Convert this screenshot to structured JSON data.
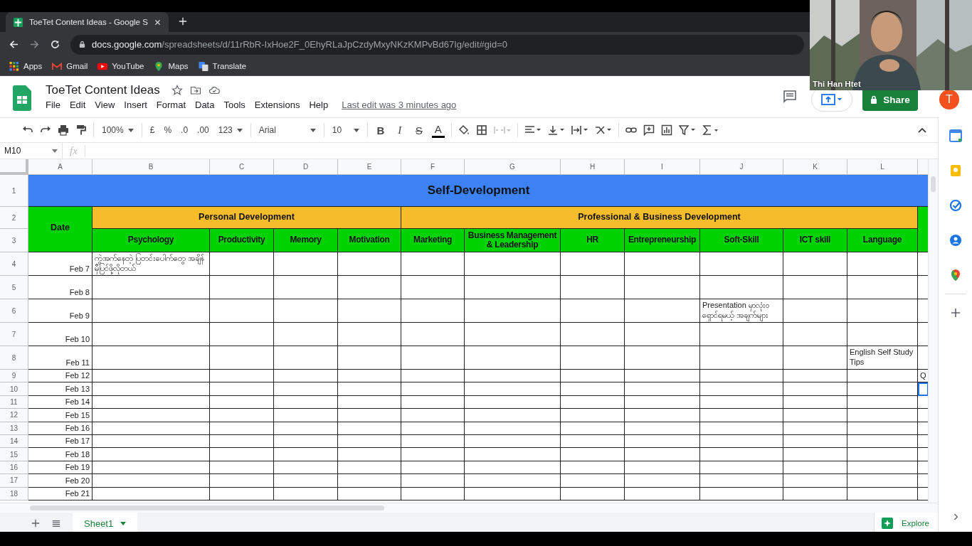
{
  "browser": {
    "tab_title": "ToeTet Content Ideas - Google S",
    "url_host": "docs.google.com",
    "url_path": "/spreadsheets/d/11rRbR-IxHoe2F_0EhyRLaJpCzdyMxyNKzKMPvBd67Ig/edit#gid=0",
    "bookmarks": [
      {
        "label": "Apps",
        "kind": "apps"
      },
      {
        "label": "Gmail",
        "kind": "gmail"
      },
      {
        "label": "YouTube",
        "kind": "youtube"
      },
      {
        "label": "Maps",
        "kind": "maps"
      },
      {
        "label": "Translate",
        "kind": "translate"
      }
    ]
  },
  "video": {
    "name": "Thi Han Htet"
  },
  "doc": {
    "title": "ToeTet Content Ideas",
    "menu": [
      "File",
      "Edit",
      "View",
      "Insert",
      "Format",
      "Data",
      "Tools",
      "Extensions",
      "Help"
    ],
    "last_edit": "Last edit was 3 minutes ago",
    "share": "Share",
    "avatar": "T"
  },
  "toolbar": {
    "zoom": "100%",
    "currency": "£",
    "percent": "%",
    "dec_less": ".0",
    "dec_more": ".00",
    "number_format": "123",
    "font": "Arial",
    "size": "10",
    "bold": "B",
    "italic": "I",
    "strike": "S",
    "text_color": "A"
  },
  "formula_bar": {
    "name_box": "M10",
    "fx": "fx"
  },
  "sheet": {
    "columns": [
      "A",
      "B",
      "C",
      "D",
      "E",
      "F",
      "G",
      "H",
      "I",
      "J",
      "K",
      "L"
    ],
    "title_row": {
      "number": "1",
      "text": "Self-Development"
    },
    "header_rows": {
      "numbers": [
        "2",
        "3"
      ],
      "date_label": "Date",
      "groups": [
        {
          "label": "Personal Development",
          "columns": [
            "Psychology",
            "Productivity",
            "Memory",
            "Motivation"
          ]
        },
        {
          "label": "Professional & Business Development",
          "columns": [
            "Marketing",
            "Business Management & Leadership",
            "HR",
            "Entrepreneurship",
            "Soft-Skill",
            "ICT skill",
            "Language"
          ]
        }
      ]
    },
    "rows": [
      {
        "number": "4",
        "tall": true,
        "selected": false,
        "cells": {
          "col_a": "Feb 7",
          "col_b": "ကွဲအက်နေတဲ့ ပြတင်းပေါက်တွေ အချိန်မှီပြင်ဖို့လိုတယ်"
        }
      },
      {
        "number": "5",
        "tall": true,
        "selected": false,
        "cells": {
          "col_a": "Feb 8"
        }
      },
      {
        "number": "6",
        "tall": true,
        "selected": false,
        "cells": {
          "col_a": "Feb 9",
          "col_j": "Presentation မှာလုံးဝ ရှောင်ရမယ့် အချက်များ"
        }
      },
      {
        "number": "7",
        "tall": true,
        "selected": false,
        "cells": {
          "col_a": "Feb 10"
        }
      },
      {
        "number": "8",
        "tall": true,
        "selected": false,
        "cells": {
          "col_a": "Feb 11",
          "col_l": "English Self Study Tips"
        }
      },
      {
        "number": "9",
        "tall": false,
        "selected": false,
        "cells": {
          "col_a": "Feb 12",
          "col_m": "Q"
        }
      },
      {
        "number": "10",
        "tall": false,
        "selected": true,
        "cells": {
          "col_a": "Feb 13"
        }
      },
      {
        "number": "11",
        "tall": false,
        "selected": false,
        "cells": {
          "col_a": "Feb 14"
        }
      },
      {
        "number": "12",
        "tall": false,
        "selected": false,
        "cells": {
          "col_a": "Feb 15"
        }
      },
      {
        "number": "13",
        "tall": false,
        "selected": false,
        "cells": {
          "col_a": "Feb 16"
        }
      },
      {
        "number": "14",
        "tall": false,
        "selected": false,
        "cells": {
          "col_a": "Feb 17"
        }
      },
      {
        "number": "15",
        "tall": false,
        "selected": false,
        "cells": {
          "col_a": "Feb 18"
        }
      },
      {
        "number": "16",
        "tall": false,
        "selected": false,
        "cells": {
          "col_a": "Feb 19"
        }
      },
      {
        "number": "17",
        "tall": false,
        "selected": false,
        "cells": {
          "col_a": "Feb 20"
        }
      },
      {
        "number": "18",
        "tall": false,
        "selected": false,
        "cells": {
          "col_a": "Feb 21"
        }
      }
    ]
  },
  "sheet_tabs": [
    {
      "label": "Sheet1",
      "selected": true
    }
  ],
  "explore": "Explore"
}
